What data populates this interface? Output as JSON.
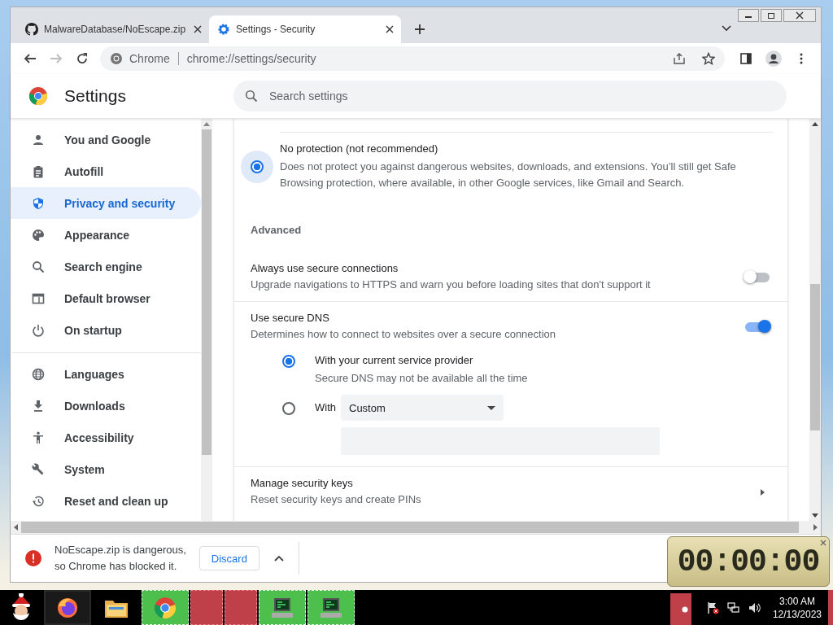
{
  "tabs": [
    {
      "title": "MalwareDatabase/NoEscape.zip",
      "kind": "github",
      "selected": false
    },
    {
      "title": "Settings - Security",
      "kind": "gear",
      "selected": true
    }
  ],
  "address_bar": {
    "origin": "Chrome",
    "url": "chrome://settings/security"
  },
  "header": {
    "title": "Settings",
    "search_placeholder": "Search settings"
  },
  "sidebar": {
    "groups": [
      {
        "items": [
          {
            "label": "You and Google",
            "kind": "person",
            "selected": false
          },
          {
            "label": "Autofill",
            "kind": "clipboard",
            "selected": false
          },
          {
            "label": "Privacy and security",
            "kind": "shield",
            "selected": true
          },
          {
            "label": "Appearance",
            "kind": "palette",
            "selected": false
          },
          {
            "label": "Search engine",
            "kind": "search",
            "selected": false
          },
          {
            "label": "Default browser",
            "kind": "browser",
            "selected": false
          },
          {
            "label": "On startup",
            "kind": "power",
            "selected": false
          }
        ]
      },
      {
        "items": [
          {
            "label": "Languages",
            "kind": "globe",
            "selected": false
          },
          {
            "label": "Downloads",
            "kind": "download",
            "selected": false
          },
          {
            "label": "Accessibility",
            "kind": "accessibility",
            "selected": false
          },
          {
            "label": "System",
            "kind": "wrench",
            "selected": false
          },
          {
            "label": "Reset and clean up",
            "kind": "history",
            "selected": false
          }
        ]
      }
    ]
  },
  "protection_option": {
    "title": "No protection (not recommended)",
    "description": "Does not protect you against dangerous websites, downloads, and extensions. You’ll still get Safe Browsing protection, where available, in other Google services, like Gmail and Search.",
    "selected": true
  },
  "advanced_heading": "Advanced",
  "rows": [
    {
      "kind": "toggle",
      "title": "Always use secure connections",
      "description": "Upgrade navigations to HTTPS and warn you before loading sites that don't support it",
      "on": false
    },
    {
      "kind": "toggle",
      "title": "Use secure DNS",
      "description": "Determines how to connect to websites over a secure connection",
      "on": true,
      "options": [
        {
          "kind": "radio",
          "title": "With your current service provider",
          "description": "Secure DNS may not be available all the time",
          "selected": true
        },
        {
          "kind": "custom",
          "label": "With",
          "dropdown": "Custom",
          "selected": false
        }
      ]
    },
    {
      "kind": "link",
      "title": "Manage security keys",
      "description": "Reset security keys and create PINs"
    }
  ],
  "download_bar": {
    "message_lines": [
      "NoEscape.zip is dangerous,",
      "so Chrome has blocked it."
    ],
    "button": "Discard"
  },
  "timer": {
    "display": "00:00:00"
  },
  "taskbar": {
    "apps": [
      {
        "kind": "firefox"
      },
      {
        "kind": "folder"
      },
      {
        "kind": "chrome"
      },
      {
        "kind": "blank"
      },
      {
        "kind": "blank"
      },
      {
        "kind": "computer"
      },
      {
        "kind": "computer"
      }
    ],
    "clock": {
      "time": "3:00 AM",
      "date": "12/13/2023"
    }
  }
}
